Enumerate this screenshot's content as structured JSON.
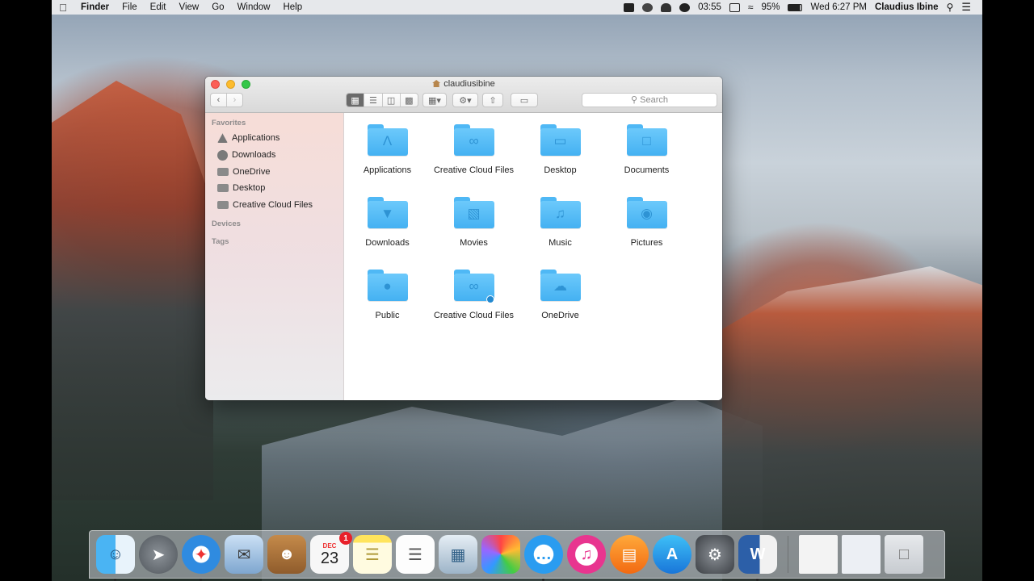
{
  "menubar": {
    "app_name": "Finder",
    "menus": [
      "File",
      "Edit",
      "View",
      "Go",
      "Window",
      "Help"
    ],
    "clock_small": "03:55",
    "battery": "95%",
    "datetime": "Wed 6:27 PM",
    "user": "Claudius Ibine"
  },
  "window": {
    "title": "claudiusibine",
    "search_placeholder": "Search"
  },
  "sidebar": {
    "favorites_label": "Favorites",
    "devices_label": "Devices",
    "tags_label": "Tags",
    "items": [
      {
        "label": "Applications",
        "icon": "applications-icon"
      },
      {
        "label": "Downloads",
        "icon": "downloads-icon"
      },
      {
        "label": "OneDrive",
        "icon": "folder-icon"
      },
      {
        "label": "Desktop",
        "icon": "desktop-folder-icon"
      },
      {
        "label": "Creative Cloud Files",
        "icon": "folder-icon"
      }
    ]
  },
  "folders": [
    {
      "label": "Applications",
      "icon": "applications-folder-icon"
    },
    {
      "label": "Creative Cloud Files",
      "icon": "creative-cloud-folder-icon"
    },
    {
      "label": "Desktop",
      "icon": "desktop-folder-icon"
    },
    {
      "label": "Documents",
      "icon": "documents-folder-icon"
    },
    {
      "label": "Downloads",
      "icon": "downloads-folder-icon"
    },
    {
      "label": "Movies",
      "icon": "movies-folder-icon"
    },
    {
      "label": "Music",
      "icon": "music-folder-icon"
    },
    {
      "label": "Pictures",
      "icon": "pictures-folder-icon"
    },
    {
      "label": "Public",
      "icon": "public-folder-icon"
    },
    {
      "label": "Creative Cloud Files",
      "icon": "creative-cloud-folder-icon"
    },
    {
      "label": "OneDrive",
      "icon": "onedrive-folder-icon"
    }
  ],
  "dock": {
    "calendar_month": "DEC",
    "calendar_day": "23",
    "calendar_badge": "1",
    "apps": [
      "finder",
      "launchpad",
      "safari",
      "mail",
      "contacts",
      "calendar",
      "notes",
      "reminders",
      "preview",
      "photos",
      "messages",
      "itunes",
      "ibooks",
      "app-store",
      "system-preferences",
      "word"
    ]
  }
}
